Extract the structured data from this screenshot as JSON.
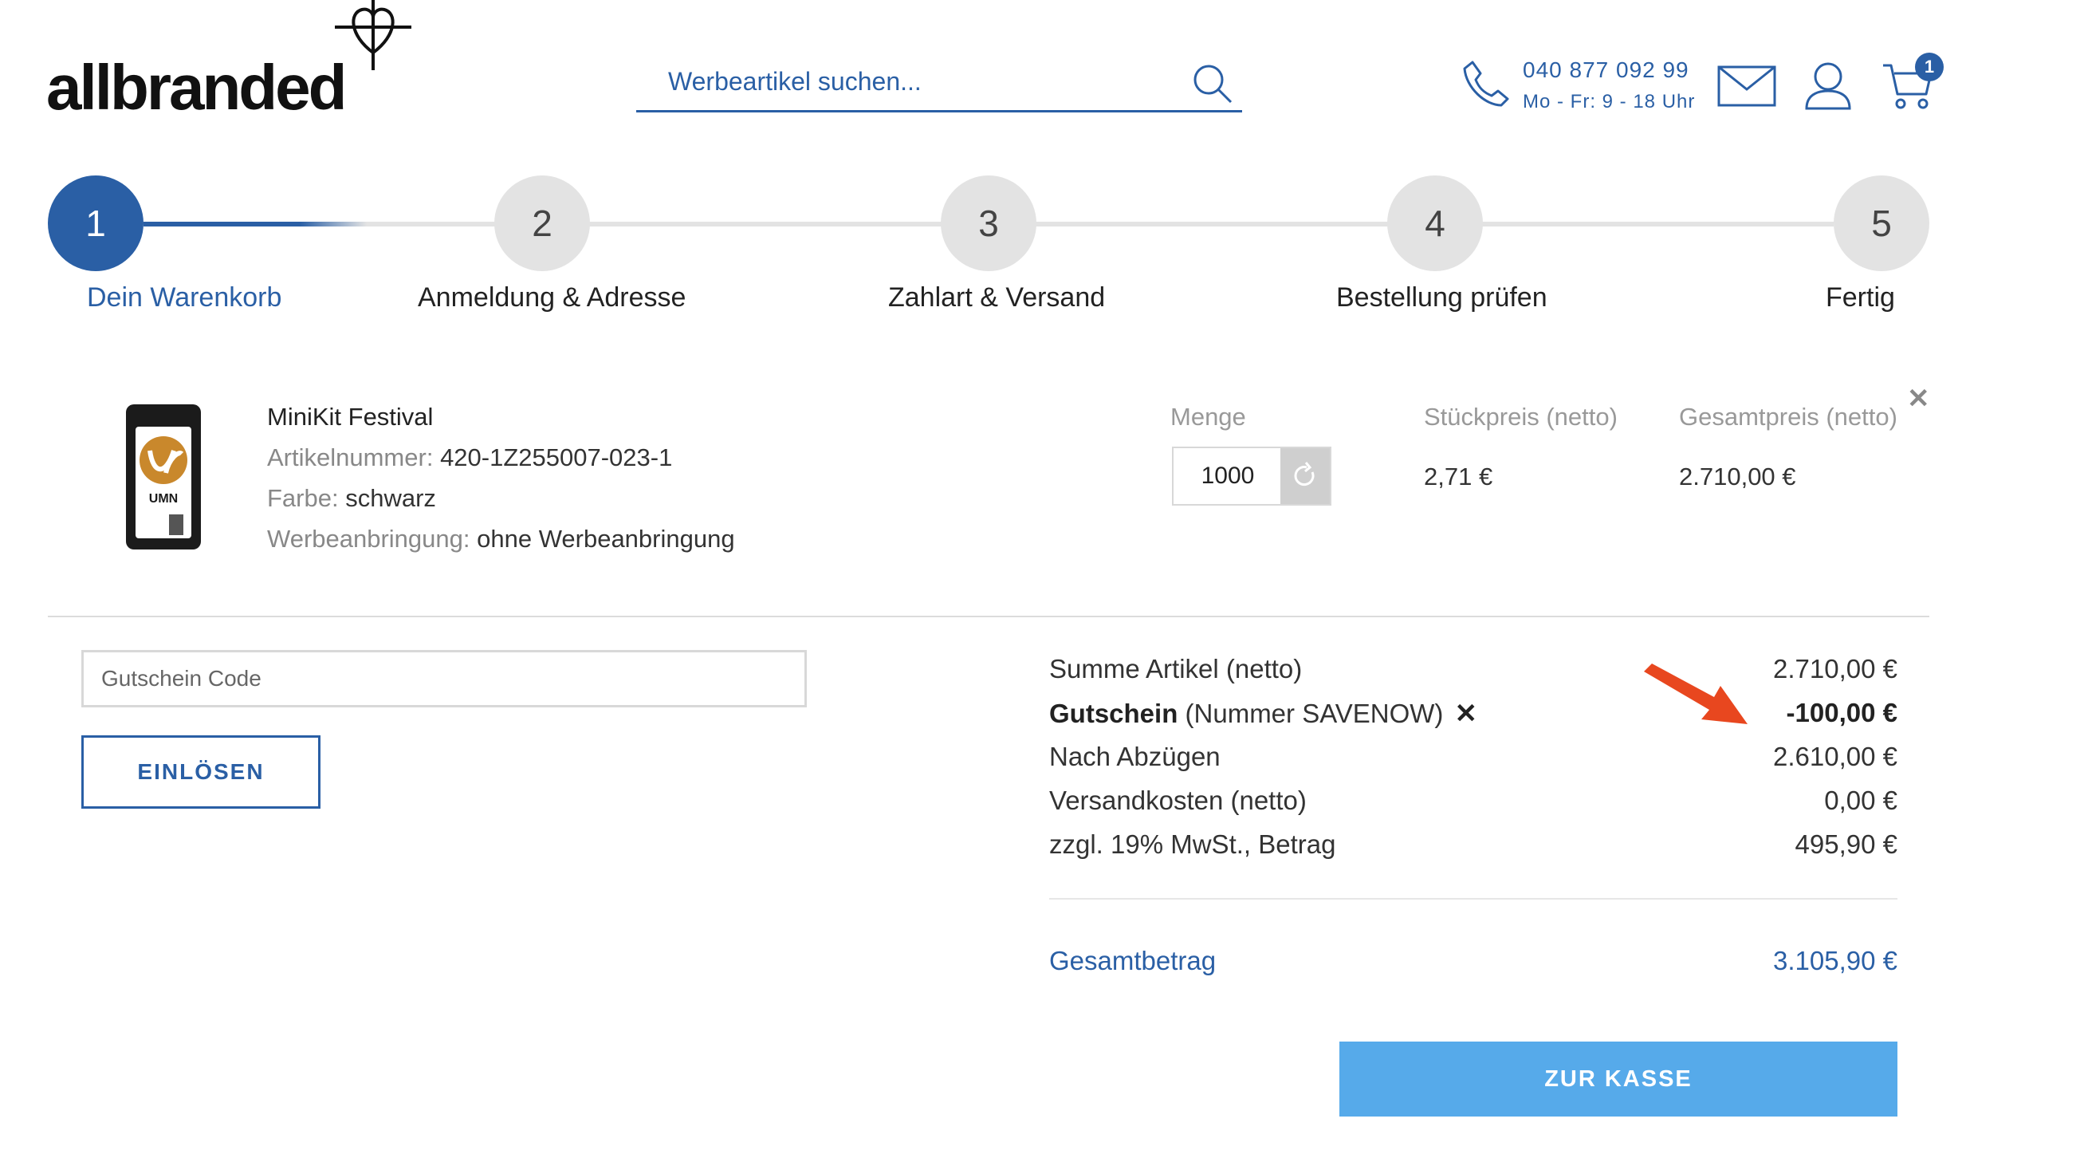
{
  "header": {
    "logo": "allbranded",
    "search_placeholder": "Werbeartikel suchen...",
    "phone": "040 877 092 99",
    "hours": "Mo - Fr: 9 - 18 Uhr",
    "cart_count": "1"
  },
  "steps": [
    {
      "num": "1",
      "label": "Dein Warenkorb",
      "active": true
    },
    {
      "num": "2",
      "label": "Anmeldung & Adresse",
      "active": false
    },
    {
      "num": "3",
      "label": "Zahlart & Versand",
      "active": false
    },
    {
      "num": "4",
      "label": "Bestellung prüfen",
      "active": false
    },
    {
      "num": "5",
      "label": "Fertig",
      "active": false
    }
  ],
  "item": {
    "name": "MiniKit Festival",
    "article_label": "Artikelnummer:",
    "article_value": "420-1Z255007-023-1",
    "color_label": "Farbe:",
    "color_value": "schwarz",
    "branding_label": "Werbeanbringung:",
    "branding_value": "ohne Werbeanbringung",
    "qty_header": "Menge",
    "qty_value": "1000",
    "unit_header": "Stückpreis (netto)",
    "unit_price": "2,71 €",
    "total_header": "Gesamtpreis (netto)",
    "total_price": "2.710,00 €",
    "remove": "✕",
    "logo_text": "UMN"
  },
  "coupon": {
    "placeholder": "Gutschein Code",
    "button": "EINLÖSEN"
  },
  "summary": {
    "rows": [
      {
        "label": "Summe Artikel (netto)",
        "value": "2.710,00 €"
      },
      {
        "label_bold": "Gutschein",
        "label": "(Nummer SAVENOW)",
        "value": "-100,00 €",
        "remove": "✕"
      },
      {
        "label": "Nach Abzügen",
        "value": "2.610,00 €"
      },
      {
        "label": "Versandkosten (netto)",
        "value": "0,00 €"
      },
      {
        "label": "zzgl. 19% MwSt., Betrag",
        "value": "495,90 €"
      }
    ],
    "total_label": "Gesamtbetrag",
    "total_value": "3.105,90 €",
    "checkout": "ZUR KASSE"
  },
  "colors": {
    "brand_blue": "#2a5fa5",
    "checkout_blue": "#56aaea",
    "arrow_red": "#e8471f"
  }
}
